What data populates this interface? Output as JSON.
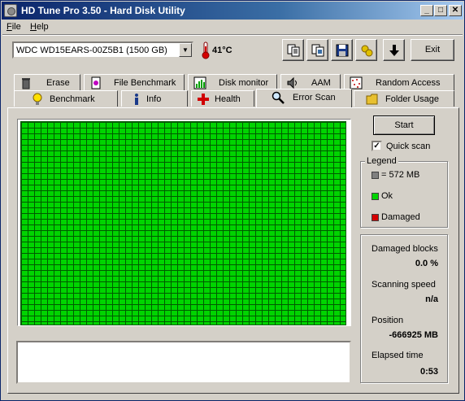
{
  "window": {
    "title": "HD Tune Pro 3.50 - Hard Disk Utility",
    "controls": {
      "minimize": "_",
      "maximize": "□",
      "close": "✕"
    }
  },
  "menu": {
    "file": "File",
    "help": "Help"
  },
  "toolbar": {
    "drive": "WDC WD15EARS-00Z5B1 (1500 GB)",
    "temperature": "41°C",
    "exit_label": "Exit",
    "icons": [
      "copy-text-icon",
      "copy-screenshot-icon",
      "save-icon",
      "options-icon",
      "download-arrow-icon"
    ]
  },
  "tabs_top": [
    {
      "label": "Erase",
      "icon": "trash-icon"
    },
    {
      "label": "File Benchmark",
      "icon": "file-benchmark-icon"
    },
    {
      "label": "Disk monitor",
      "icon": "disk-monitor-icon"
    },
    {
      "label": "AAM",
      "icon": "speaker-icon"
    },
    {
      "label": "Random Access",
      "icon": "random-access-icon"
    }
  ],
  "tabs_bottom": [
    {
      "label": "Benchmark",
      "icon": "lightbulb-icon"
    },
    {
      "label": "Info",
      "icon": "info-icon"
    },
    {
      "label": "Health",
      "icon": "health-cross-icon"
    },
    {
      "label": "Error Scan",
      "icon": "magnifier-icon",
      "active": true
    },
    {
      "label": "Folder Usage",
      "icon": "folder-icon"
    }
  ],
  "scan": {
    "start_label": "Start",
    "quick_scan_label": "Quick scan",
    "quick_scan_checked": true,
    "check_mark": "✓"
  },
  "legend": {
    "title": "Legend",
    "items": [
      {
        "label": "= 572 MB",
        "color": "#808080"
      },
      {
        "label": "Ok",
        "color": "#00d400"
      },
      {
        "label": "Damaged",
        "color": "#d40000"
      }
    ]
  },
  "stats": {
    "damaged_blocks_label": "Damaged blocks",
    "damaged_blocks_value": "0.0 %",
    "scanning_speed_label": "Scanning speed",
    "scanning_speed_value": "n/a",
    "position_label": "Position",
    "position_value": "-666925 MB",
    "elapsed_label": "Elapsed time",
    "elapsed_value": "0:53"
  },
  "colors": {
    "block_ok": "#00d400",
    "block_grid": "#005a00",
    "titlebar_start": "#0a246a",
    "titlebar_end": "#a6caf0"
  }
}
